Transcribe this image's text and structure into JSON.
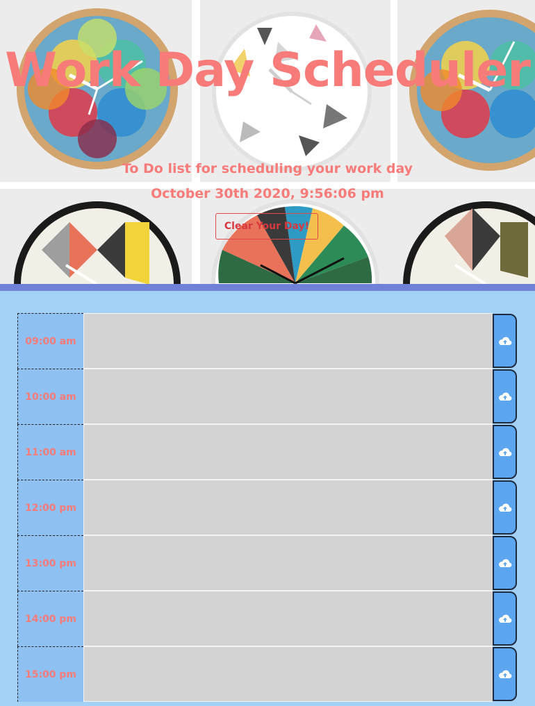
{
  "header": {
    "title": "Work Day Scheduler",
    "subtitle": "To Do list for scheduling your work day",
    "datetime": "October 30th 2020, 9:56:06 pm",
    "clear_label": "Clear Your Day!"
  },
  "colors": {
    "accent": "#f77b79",
    "page_bg": "#a3d0f5",
    "hour_bg": "#8fc0f2",
    "textarea_bg": "#d3d3d3",
    "save_bg": "#5ba6ef",
    "divider": "#6f82d6"
  },
  "schedule": {
    "rows": [
      {
        "hour": "09:00 am",
        "text": ""
      },
      {
        "hour": "10:00 am",
        "text": ""
      },
      {
        "hour": "11:00 am",
        "text": ""
      },
      {
        "hour": "12:00 pm",
        "text": ""
      },
      {
        "hour": "13:00 pm",
        "text": ""
      },
      {
        "hour": "14:00 pm",
        "text": ""
      },
      {
        "hour": "15:00 pm",
        "text": ""
      }
    ],
    "save_icon": "cloud-upload-icon"
  }
}
